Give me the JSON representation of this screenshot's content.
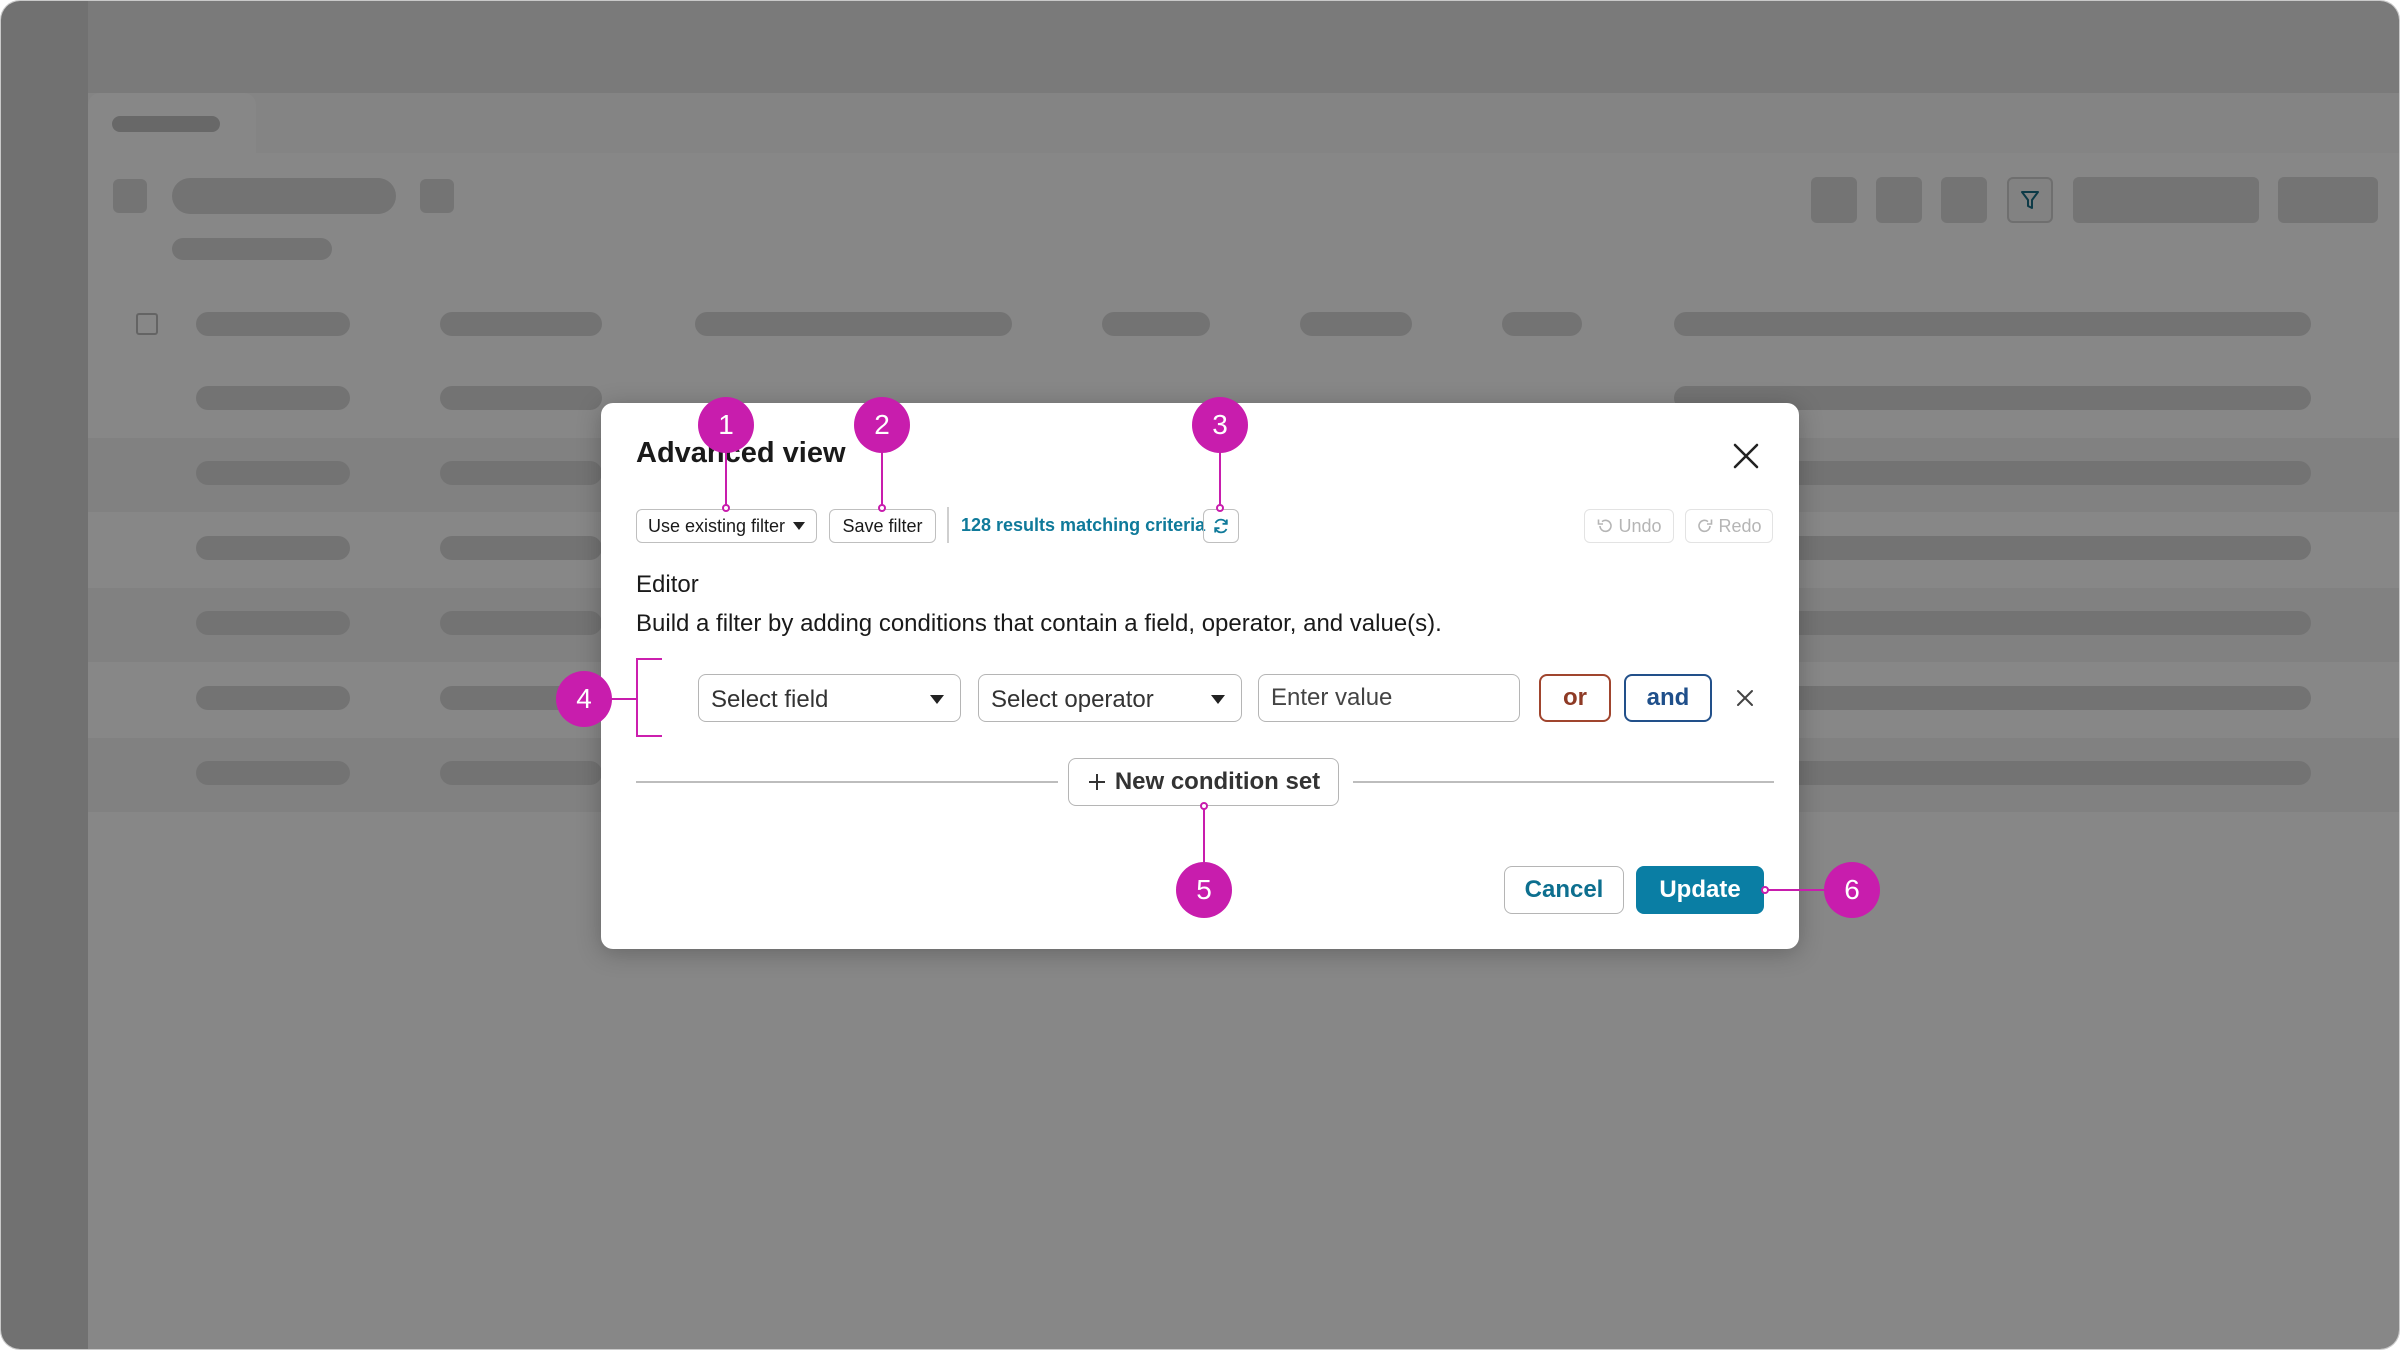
{
  "modal": {
    "title": "Advanced view",
    "toolbar": {
      "use_existing_filter": "Use existing filter",
      "save_filter": "Save filter",
      "results_text": "128 results matching criteria",
      "undo": "Undo",
      "redo": "Redo"
    },
    "editor": {
      "title": "Editor",
      "description": "Build a filter by adding conditions that contain a field, operator, and value(s).",
      "condition": {
        "field_select": "Select field",
        "operator_select": "Select operator",
        "value_placeholder": "Enter value",
        "or_label": "or",
        "and_label": "and"
      },
      "new_condition_set": "New condition set"
    },
    "footer": {
      "cancel": "Cancel",
      "update": "Update"
    }
  },
  "callouts": [
    "1",
    "2",
    "3",
    "4",
    "5",
    "6"
  ],
  "colors": {
    "callout": "#c81dad",
    "primary": "#0a7ea4",
    "link": "#0f7a9a",
    "or": "#8e3a25",
    "and": "#1f4f8a"
  },
  "icons": [
    "close-icon",
    "caret-down-icon",
    "refresh-icon",
    "undo-icon",
    "redo-icon",
    "plus-icon",
    "remove-condition-icon",
    "filter-icon"
  ]
}
